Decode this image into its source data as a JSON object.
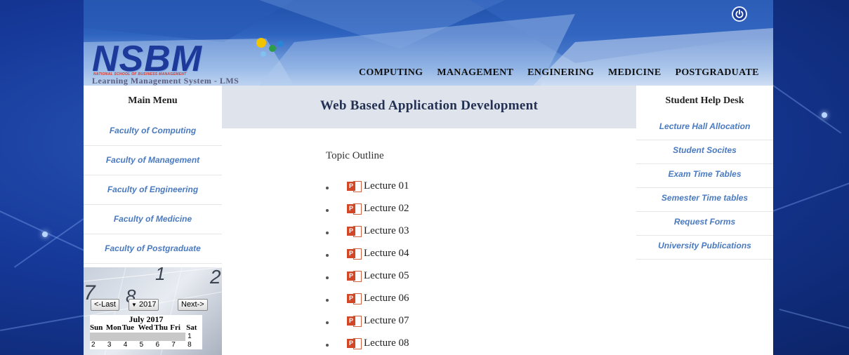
{
  "header": {
    "logo_main": "NSBM",
    "logo_sub": "NATIONAL SCHOOL OF BUSINESS MANAGEMENT",
    "logo_lms": "Learning Management System - LMS",
    "nav": [
      "COMPUTING",
      "MANAGEMENT",
      "ENGINERING",
      "MEDICINE",
      "POSTGRADUATE"
    ]
  },
  "left_menu": {
    "title": "Main Menu",
    "items": [
      "Faculty of Computing",
      "Faculty of Management",
      "Faculty of Engineering",
      "Faculty of Medicine",
      "Faculty of Postgraduate"
    ]
  },
  "calendar": {
    "prev_label": "<-Last",
    "year": "2017",
    "next_label": "Next->",
    "month": "July 2017",
    "days": [
      "Sun",
      "Mon",
      "Tue",
      "Wed",
      "Thu",
      "Fri",
      "Sat"
    ],
    "week1": [
      "",
      "",
      "",
      "",
      "",
      "",
      "1"
    ],
    "week2": [
      "2",
      "3",
      "4",
      "5",
      "6",
      "7",
      "8"
    ]
  },
  "main": {
    "course_title": "Web Based Application Development",
    "topic_outline": "Topic Outline",
    "lectures": [
      "Lecture 01",
      "Lecture 02",
      "Lecture 03",
      "Lecture 04",
      "Lecture 05",
      "Lecture 06",
      "Lecture 07",
      "Lecture 08"
    ]
  },
  "right_menu": {
    "title": "Student Help Desk",
    "items": [
      "Lecture Hall Allocation",
      "Student Socites",
      "Exam Time Tables",
      "Semester Time tables",
      "Request Forms",
      "University Publications"
    ]
  },
  "colors": {
    "link": "#4a7ac0",
    "ppt_orange": "#d24726",
    "banner": "#dfe4ec",
    "background_blue": "#16399a"
  },
  "icons": {
    "power": "power-icon",
    "lecture": "powerpoint-icon"
  }
}
